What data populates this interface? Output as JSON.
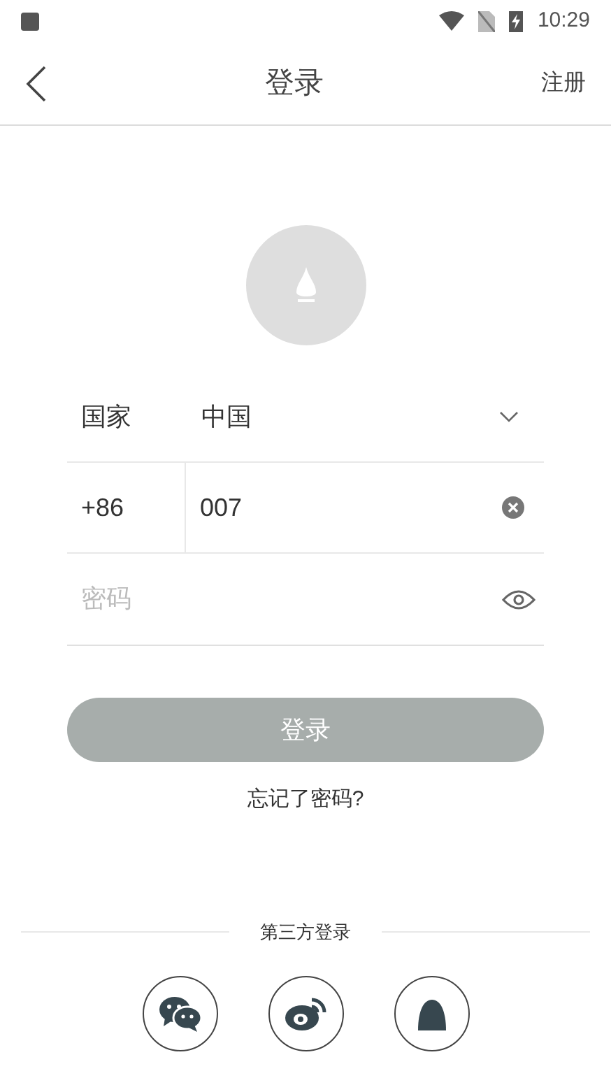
{
  "status_bar": {
    "time": "10:29"
  },
  "header": {
    "title": "登录",
    "action": "注册"
  },
  "country": {
    "label": "国家",
    "value": "中国"
  },
  "phone": {
    "code": "+86",
    "value": "007"
  },
  "password": {
    "placeholder": "密码"
  },
  "login_button": "登录",
  "forgot_link": "忘记了密码?",
  "third_party": {
    "label": "第三方登录",
    "providers": [
      {
        "kind": "wechat"
      },
      {
        "kind": "weibo"
      },
      {
        "kind": "qq"
      }
    ]
  }
}
